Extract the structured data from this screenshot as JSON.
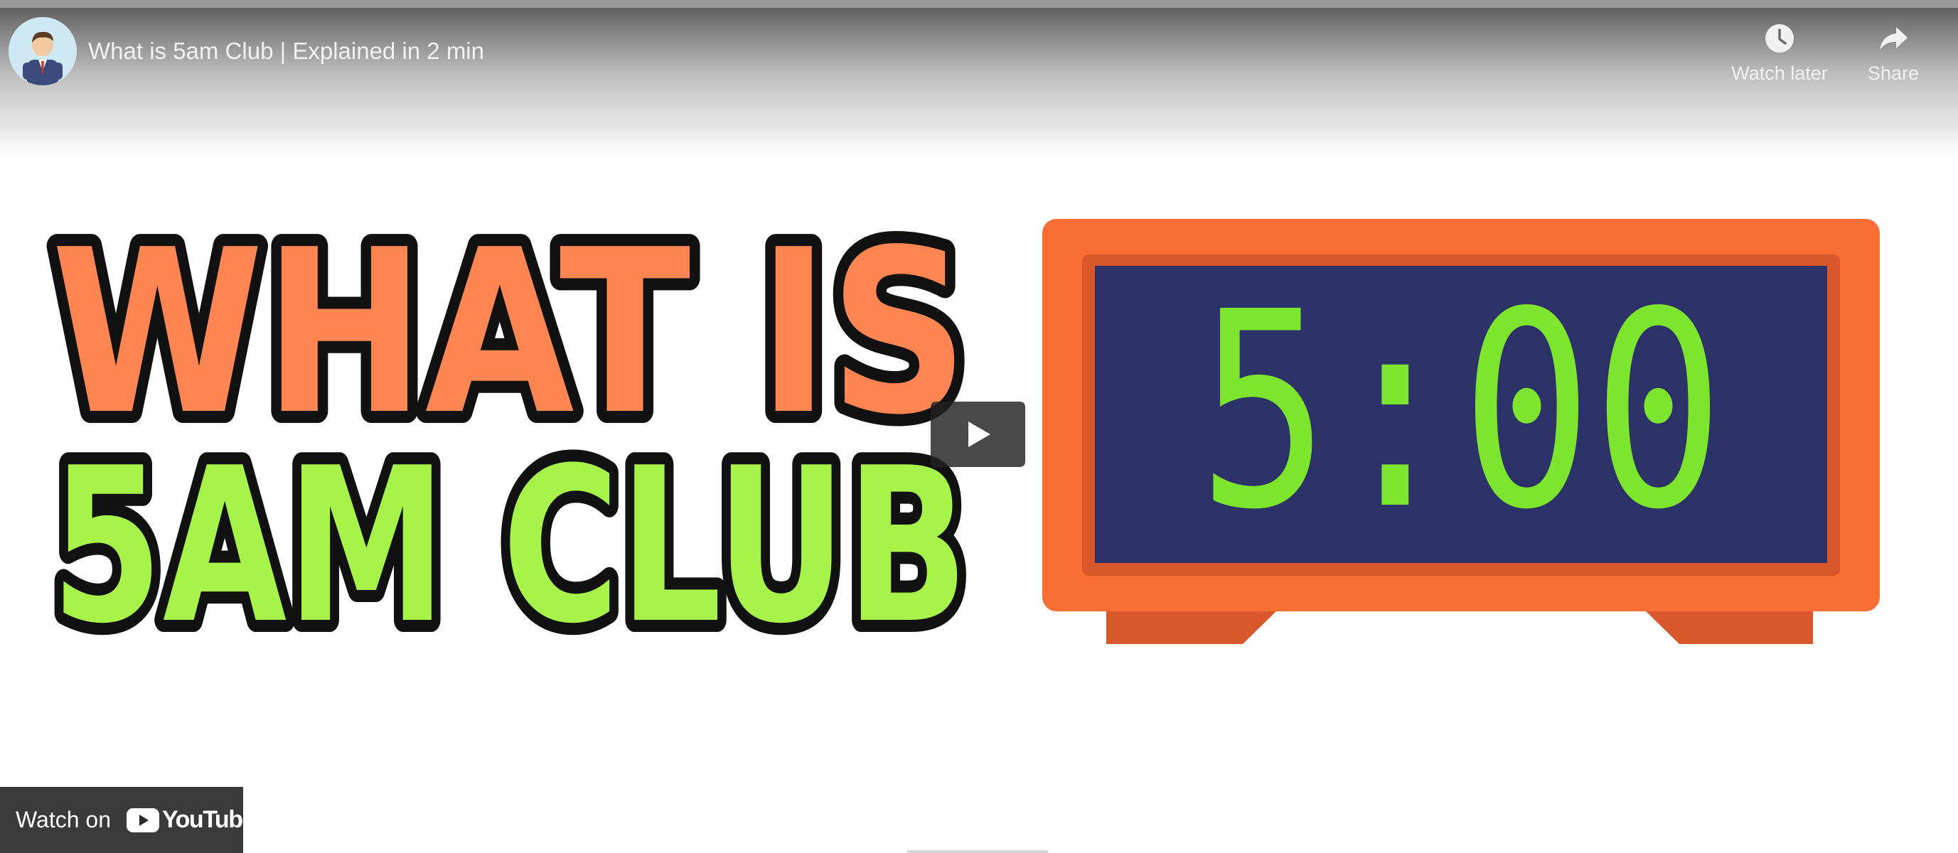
{
  "video": {
    "title": "What is 5am Club | Explained in 2 min",
    "channel_avatar_icon": "cartoon-businessman-avatar"
  },
  "actions": {
    "watch_later_label": "Watch later",
    "watch_later_icon": "clock-icon",
    "share_label": "Share",
    "share_icon": "share-arrow-icon"
  },
  "thumbnail": {
    "headline_line1": "WHAT IS",
    "headline_line2": "5AM CLUB",
    "clock_display": "5:00",
    "colors": {
      "headline_line1": "#ff8552",
      "headline_line2": "#a8f34a",
      "outline": "#111111",
      "clock_body": "#f76d33",
      "clock_screen": "#2c3167",
      "clock_digits": "#7ee52f"
    }
  },
  "player": {
    "play_icon": "play-icon",
    "watch_on_label": "Watch on",
    "youtube_wordmark": "YouTube"
  }
}
